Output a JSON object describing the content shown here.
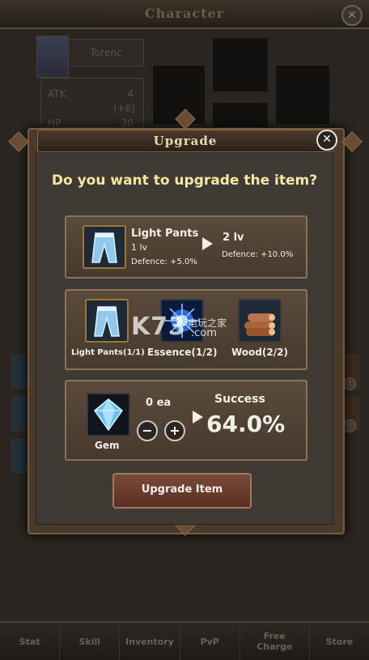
{
  "background_screen": {
    "title": "Character",
    "close_icon": "close-icon",
    "character_name": "Torenc",
    "stats": [
      {
        "label": "ATK",
        "value": "4",
        "bonus": "(+6)"
      },
      {
        "label": "HP",
        "value": "30"
      }
    ]
  },
  "modal": {
    "title": "Upgrade",
    "question": "Do you want to upgrade the item?",
    "close_icon": "close-icon",
    "item": {
      "icon": "pants-icon",
      "name": "Light Pants",
      "level": "1 lv",
      "stat": "Defence: +5.0%",
      "next_level": "2 lv",
      "next_stat": "Defence: +10.0%"
    },
    "materials": [
      {
        "icon": "pants-icon",
        "label": "Light Pants(1/1)"
      },
      {
        "icon": "essence-icon",
        "label": "Essence(1/2)"
      },
      {
        "icon": "wood-icon",
        "label": "Wood(2/2)"
      }
    ],
    "gem": {
      "icon": "gem-icon",
      "label": "Gem",
      "count": "0 ea",
      "minus": "−",
      "plus": "+"
    },
    "success_label": "Success",
    "success_rate": "64.0%",
    "upgrade_button": "Upgrade Item"
  },
  "watermark": {
    "logo": "K73",
    "sub": "电玩之家",
    "domain": ".com"
  },
  "bottom_nav": [
    "Stat",
    "Skill",
    "Inventory",
    "PvP",
    "Free Charge",
    "Store"
  ],
  "colors": {
    "question_text": "#f5e7a4",
    "panel_border": "#8a7458",
    "button_bg": "#6a3c2e",
    "modal_title": "#e8d9b0"
  }
}
